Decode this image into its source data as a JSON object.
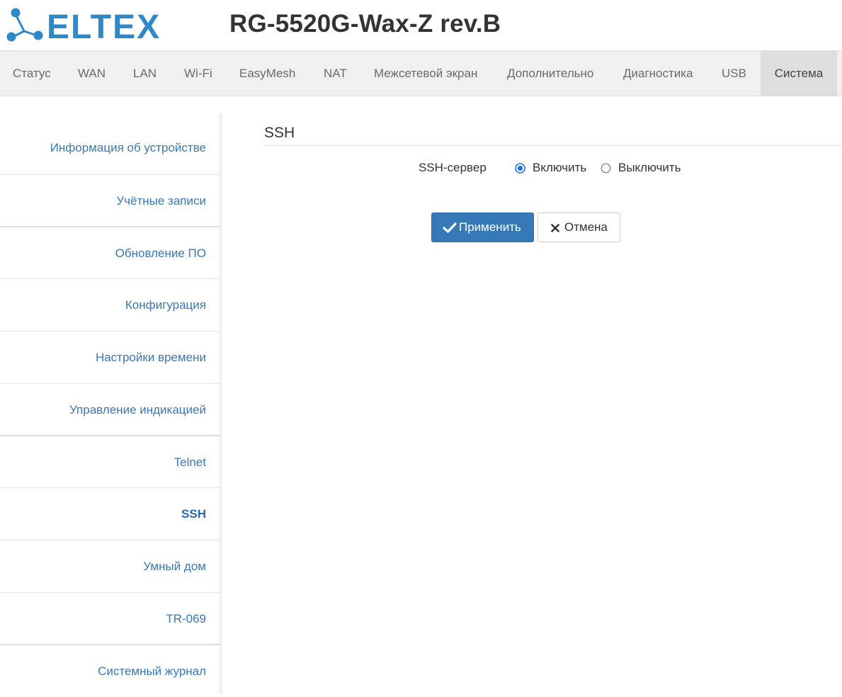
{
  "header": {
    "logo_text": "ELTEX",
    "device_model": "RG-5520G-Wax-Z rev.B"
  },
  "nav": {
    "items": [
      "Статус",
      "WAN",
      "LAN",
      "Wi-Fi",
      "EasyMesh",
      "NAT",
      "Межсетевой экран",
      "Дополнительно",
      "Диагностика",
      "USB",
      "Система"
    ],
    "active": "Система"
  },
  "sidebar": {
    "items": [
      "Информация об устройстве",
      "Учётные записи",
      "Обновление ПО",
      "Конфигурация",
      "Настройки времени",
      "Управление индикацией",
      "Telnet",
      "SSH",
      "Умный дом",
      "TR-069",
      "Системный журнал"
    ],
    "active": "SSH"
  },
  "main": {
    "section_title": "SSH",
    "ssh_server": {
      "label": "SSH-сервер",
      "options": [
        "Включить",
        "Выключить"
      ],
      "selected": "Включить"
    },
    "apply_label": "Применить",
    "cancel_label": "Отмена"
  },
  "colors": {
    "logo_blue": "#2f88c8",
    "link_blue": "#3a78b5",
    "primary_button": "#3579b7"
  },
  "icons": [
    "eltex-logo-icon",
    "checkmark-icon",
    "close-icon"
  ]
}
